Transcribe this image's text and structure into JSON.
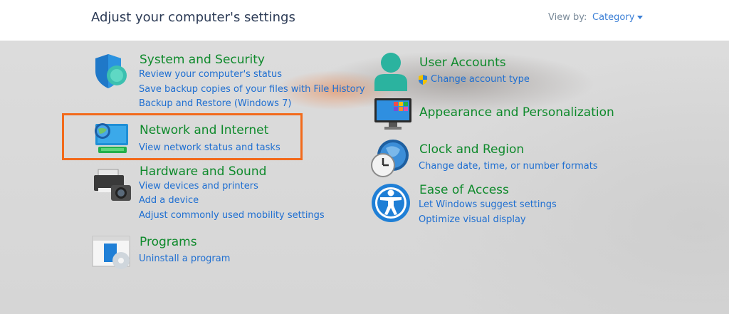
{
  "header": {
    "title": "Adjust your computer's settings",
    "view_by_label": "View by:",
    "view_by_value": "Category"
  },
  "colors": {
    "category_title": "#0f8a2c",
    "link": "#1f6fd1",
    "highlight_border": "#f26a1b"
  },
  "left_column": [
    {
      "title": "System and Security",
      "icon": "shield-icon",
      "links": [
        "Review your computer's status",
        "Save backup copies of your files with File History",
        "Backup and Restore (Windows 7)"
      ]
    },
    {
      "title": "Network and Internet",
      "icon": "network-globe-icon",
      "links": [
        "View network status and tasks"
      ]
    },
    {
      "title": "Hardware and Sound",
      "icon": "printer-icon",
      "links": [
        "View devices and printers",
        "Add a device",
        "Adjust commonly used mobility settings"
      ]
    },
    {
      "title": "Programs",
      "icon": "programs-icon",
      "links": [
        "Uninstall a program"
      ]
    }
  ],
  "right_column": [
    {
      "title": "User Accounts",
      "icon": "user-icon",
      "links": [
        "Change account type"
      ]
    },
    {
      "title": "Appearance and Personalization",
      "icon": "monitor-icon",
      "links": []
    },
    {
      "title": "Clock and Region",
      "icon": "clock-globe-icon",
      "links": [
        "Change date, time, or number formats"
      ]
    },
    {
      "title": "Ease of Access",
      "icon": "accessibility-icon",
      "links": [
        "Let Windows suggest settings",
        "Optimize visual display"
      ]
    }
  ]
}
